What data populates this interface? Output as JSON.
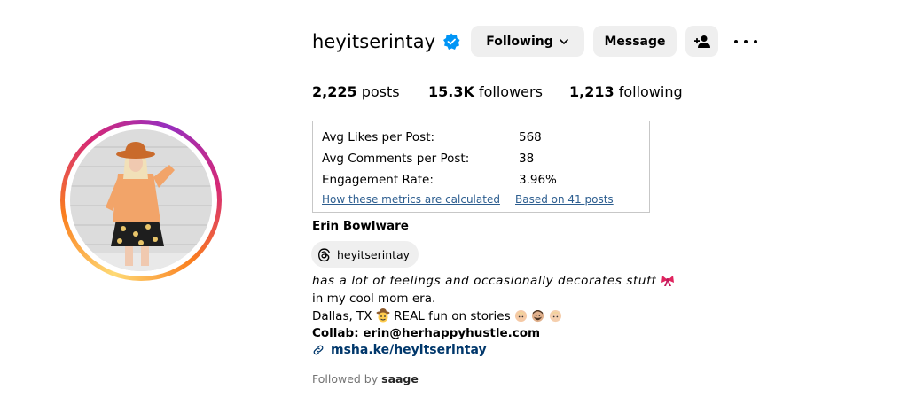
{
  "profile": {
    "username": "heyitserintay",
    "verified": true,
    "accent": "#0095f6"
  },
  "actions": {
    "following_label": "Following",
    "message_label": "Message"
  },
  "stats": {
    "posts_count": "2,225",
    "posts_label": "posts",
    "followers_count": "15.3K",
    "followers_label": "followers",
    "following_count": "1,213",
    "following_label": "following"
  },
  "metrics": {
    "avg_likes_label": "Avg Likes per Post:",
    "avg_likes_value": "568",
    "avg_comments_label": "Avg Comments per Post:",
    "avg_comments_value": "38",
    "engagement_label": "Engagement Rate:",
    "engagement_value": "3.96%",
    "how_link": "How these metrics are calculated",
    "based_on_link": "Based on 41 posts"
  },
  "bio": {
    "full_name": "Erin Bowlware",
    "threads_handle": "heyitserintay",
    "line1": "has a lot of feelings and occasionally decorates stuff",
    "line1_emoji": "ribbon",
    "line2": "in my cool mom era.",
    "line3_prefix": "Dallas, TX",
    "line3_text": "REAL fun on stories",
    "line4_label": "Collab:",
    "line4_value": "erin@herhappyhustle.com",
    "link": "msha.ke/heyitserintay",
    "followed_by_prefix": "Followed by",
    "followed_by_user": "saage"
  },
  "icons": {
    "verified": "verified-badge-icon",
    "chevron": "chevron-down-icon",
    "add_user": "add-user-icon",
    "more": "more-options-icon",
    "threads": "threads-icon",
    "link": "link-icon"
  }
}
